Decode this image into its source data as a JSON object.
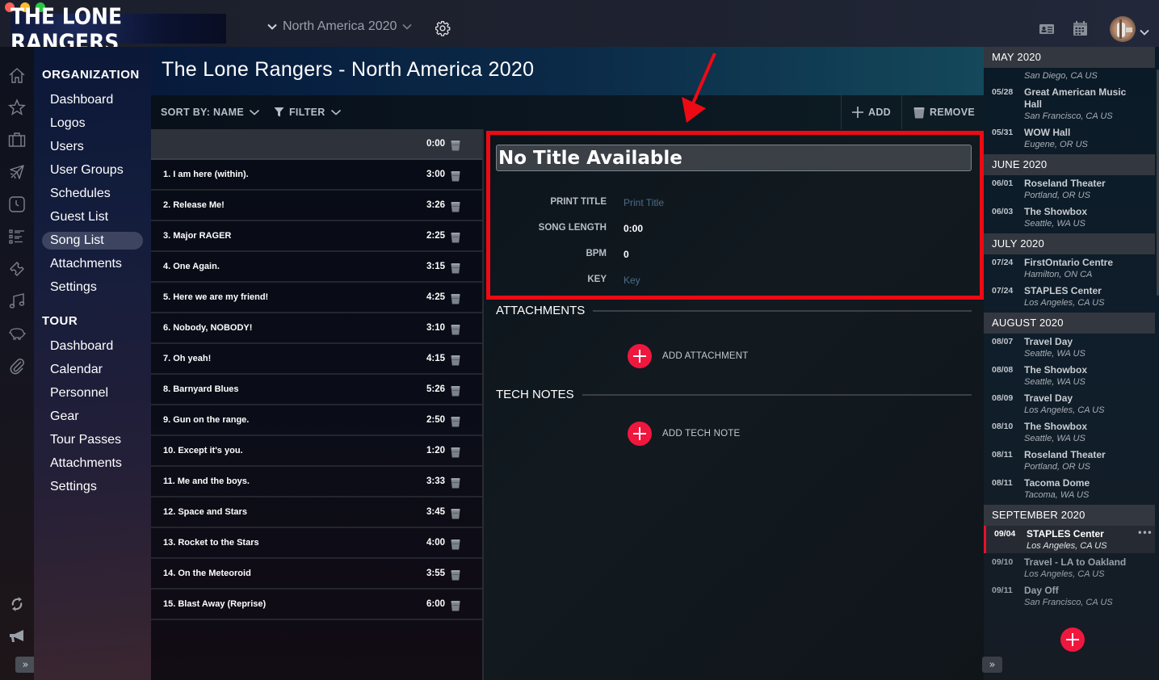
{
  "topbar": {
    "logo_text": "THE LONE RANGERS",
    "tour_select": "North America 2020",
    "icons": [
      "chevron-down-icon",
      "gear-icon",
      "contact-card-icon",
      "calendar-icon",
      "avatar",
      "chevron-down-icon"
    ]
  },
  "rail": {
    "icons": [
      "home-icon",
      "star-icon",
      "briefcase-icon",
      "airplane-icon",
      "clock-icon",
      "list-icon",
      "ticket-icon",
      "music-note-icon",
      "piggy-bank-icon",
      "paperclip-icon",
      "sync-icon",
      "megaphone-icon"
    ],
    "expand_label": "»"
  },
  "nav": {
    "organization_label": "ORGANIZATION",
    "organization_items": [
      "Dashboard",
      "Logos",
      "Users",
      "User Groups",
      "Schedules",
      "Guest List",
      "Song List",
      "Attachments",
      "Settings"
    ],
    "active_item": "Song List",
    "tour_label": "TOUR",
    "tour_items": [
      "Dashboard",
      "Calendar",
      "Personnel",
      "Gear",
      "Tour Passes",
      "Attachments",
      "Settings"
    ]
  },
  "header": {
    "title": "The Lone Rangers - North America 2020"
  },
  "toolbar": {
    "sort_label": "SORT BY: NAME",
    "filter_label": "FILTER",
    "add_label": "ADD",
    "remove_label": "REMOVE"
  },
  "songs": [
    {
      "title": "",
      "length": "0:00",
      "selected": true
    },
    {
      "title": "1. I am here (within).",
      "length": "3:00"
    },
    {
      "title": "2. Release Me!",
      "length": "3:26"
    },
    {
      "title": "3. Major RAGER",
      "length": "2:25"
    },
    {
      "title": "4. One Again.",
      "length": "3:15"
    },
    {
      "title": "5. Here we are my friend!",
      "length": "4:25"
    },
    {
      "title": "6. Nobody, NOBODY!",
      "length": "3:10"
    },
    {
      "title": "7. Oh yeah!",
      "length": "4:15"
    },
    {
      "title": "8. Barnyard Blues",
      "length": "5:26"
    },
    {
      "title": "9. Gun on the range.",
      "length": "2:50"
    },
    {
      "title": "10. Except it's you.",
      "length": "1:20"
    },
    {
      "title": "11. Me and the boys.",
      "length": "3:33"
    },
    {
      "title": "12. Space and Stars",
      "length": "3:45"
    },
    {
      "title": "13. Rocket to the Stars",
      "length": "4:00"
    },
    {
      "title": "14. On the Meteoroid",
      "length": "3:55"
    },
    {
      "title": "15. Blast Away (Reprise)",
      "length": "6:00"
    }
  ],
  "detail": {
    "title_value": "No Title Available",
    "fields": {
      "print_title_label": "PRINT TITLE",
      "print_title_placeholder": "Print Title",
      "song_length_label": "SONG LENGTH",
      "song_length_value": "0:00",
      "bpm_label": "BPM",
      "bpm_value": "0",
      "key_label": "KEY",
      "key_placeholder": "Key"
    },
    "attachments_heading": "ATTACHMENTS",
    "add_attachment_label": "ADD ATTACHMENT",
    "tech_notes_heading": "TECH NOTES",
    "add_tech_note_label": "ADD TECH NOTE"
  },
  "schedule": {
    "months": [
      {
        "label": "MAY 2020",
        "events": [
          {
            "date": "",
            "name": "",
            "place": "San Diego, CA US"
          },
          {
            "date": "05/28",
            "name": "Great American Music Hall",
            "place": "San Francisco, CA US"
          },
          {
            "date": "05/31",
            "name": "WOW Hall",
            "place": "Eugene, OR US"
          }
        ]
      },
      {
        "label": "JUNE 2020",
        "events": [
          {
            "date": "06/01",
            "name": "Roseland Theater",
            "place": "Portland, OR US"
          },
          {
            "date": "06/03",
            "name": "The Showbox",
            "place": "Seattle, WA US"
          }
        ]
      },
      {
        "label": "JULY 2020",
        "events": [
          {
            "date": "07/24",
            "name": "FirstOntario Centre",
            "place": "Hamilton, ON CA"
          },
          {
            "date": "07/24",
            "name": "STAPLES Center",
            "place": "Los Angeles, CA US"
          }
        ]
      },
      {
        "label": "AUGUST 2020",
        "events": [
          {
            "date": "08/07",
            "name": "Travel Day",
            "place": "Seattle, WA US"
          },
          {
            "date": "08/08",
            "name": "The Showbox",
            "place": "Seattle, WA US"
          },
          {
            "date": "08/09",
            "name": "Travel Day",
            "place": "Los Angeles, CA US"
          },
          {
            "date": "08/10",
            "name": "The Showbox",
            "place": "Seattle, WA US"
          },
          {
            "date": "08/11",
            "name": "Roseland Theater",
            "place": "Portland, OR US"
          },
          {
            "date": "08/11",
            "name": "Tacoma Dome",
            "place": "Tacoma, WA US"
          }
        ]
      },
      {
        "label": "SEPTEMBER 2020",
        "events": [
          {
            "date": "09/04",
            "name": "STAPLES Center",
            "place": "Los Angeles, CA US",
            "selected": true,
            "more": "•••"
          },
          {
            "date": "09/10",
            "name": "Travel - LA to Oakland",
            "place": "Los Angeles, CA US"
          },
          {
            "date": "09/11",
            "name": "Day Off",
            "place": "San Francisco, CA US"
          }
        ]
      }
    ],
    "expand_label": "»"
  },
  "colors": {
    "accent_red": "#f0173f",
    "highlight_red": "#ee0a14",
    "placeholder_blue": "#4e6a88"
  }
}
